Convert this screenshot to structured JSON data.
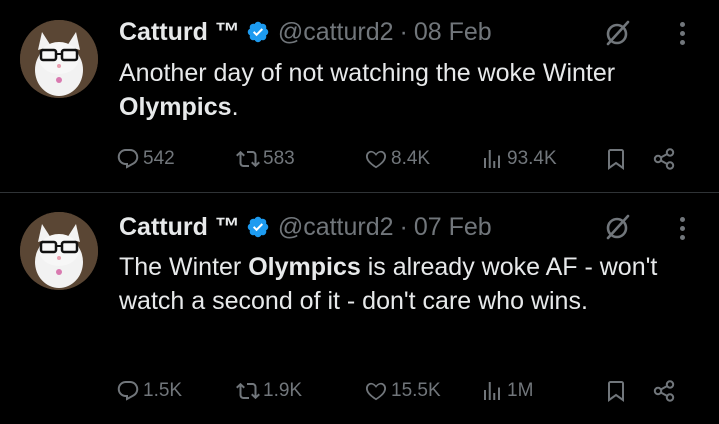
{
  "colors": {
    "background": "#000000",
    "text_primary": "#e7e9ea",
    "text_secondary": "#71767b",
    "verified_blue": "#1d9bf0",
    "divider": "#2f3336"
  },
  "tweets": [
    {
      "author": {
        "name": "Catturd ™",
        "handle": "@catturd2",
        "verified_icon": "verified-badge-icon"
      },
      "date": "08 Feb",
      "separator": "·",
      "text_parts": [
        "Another day of not watching the woke Winter ",
        "Olympics",
        "."
      ],
      "stats": {
        "replies": "542",
        "reposts": "583",
        "likes": "8.4K",
        "views": "93.4K"
      }
    },
    {
      "author": {
        "name": "Catturd ™",
        "handle": "@catturd2",
        "verified_icon": "verified-badge-icon"
      },
      "date": "07 Feb",
      "separator": "·",
      "text_parts": [
        "The Winter ",
        "Olympics",
        " is already woke AF - won't watch a second of it - don't care who wins."
      ],
      "stats": {
        "replies": "1.5K",
        "reposts": "1.9K",
        "likes": "15.5K",
        "views": "1M"
      }
    }
  ]
}
